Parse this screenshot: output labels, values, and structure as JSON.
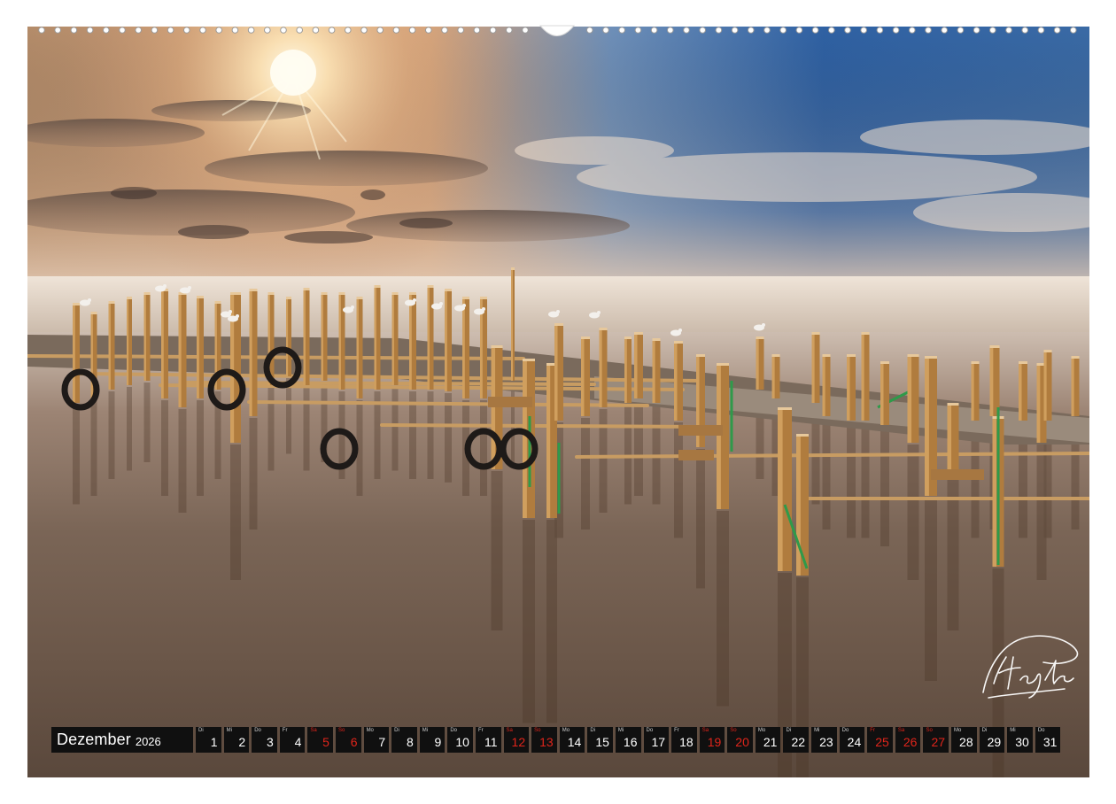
{
  "calendar": {
    "month": "Dezember",
    "year": "2026",
    "days": [
      {
        "abbr": "Di",
        "num": "1",
        "weekend": false
      },
      {
        "abbr": "Mi",
        "num": "2",
        "weekend": false
      },
      {
        "abbr": "Do",
        "num": "3",
        "weekend": false
      },
      {
        "abbr": "Fr",
        "num": "4",
        "weekend": false
      },
      {
        "abbr": "Sa",
        "num": "5",
        "weekend": true
      },
      {
        "abbr": "So",
        "num": "6",
        "weekend": true
      },
      {
        "abbr": "Mo",
        "num": "7",
        "weekend": false
      },
      {
        "abbr": "Di",
        "num": "8",
        "weekend": false
      },
      {
        "abbr": "Mi",
        "num": "9",
        "weekend": false
      },
      {
        "abbr": "Do",
        "num": "10",
        "weekend": false
      },
      {
        "abbr": "Fr",
        "num": "11",
        "weekend": false
      },
      {
        "abbr": "Sa",
        "num": "12",
        "weekend": true
      },
      {
        "abbr": "So",
        "num": "13",
        "weekend": true
      },
      {
        "abbr": "Mo",
        "num": "14",
        "weekend": false
      },
      {
        "abbr": "Di",
        "num": "15",
        "weekend": false
      },
      {
        "abbr": "Mi",
        "num": "16",
        "weekend": false
      },
      {
        "abbr": "Do",
        "num": "17",
        "weekend": false
      },
      {
        "abbr": "Fr",
        "num": "18",
        "weekend": false
      },
      {
        "abbr": "Sa",
        "num": "19",
        "weekend": true
      },
      {
        "abbr": "So",
        "num": "20",
        "weekend": true
      },
      {
        "abbr": "Mo",
        "num": "21",
        "weekend": false
      },
      {
        "abbr": "Di",
        "num": "22",
        "weekend": false
      },
      {
        "abbr": "Mi",
        "num": "23",
        "weekend": false
      },
      {
        "abbr": "Do",
        "num": "24",
        "weekend": false
      },
      {
        "abbr": "Fr",
        "num": "25",
        "weekend": true
      },
      {
        "abbr": "Sa",
        "num": "26",
        "weekend": true
      },
      {
        "abbr": "So",
        "num": "27",
        "weekend": true
      },
      {
        "abbr": "Mo",
        "num": "28",
        "weekend": false
      },
      {
        "abbr": "Di",
        "num": "29",
        "weekend": false
      },
      {
        "abbr": "Mi",
        "num": "30",
        "weekend": false
      },
      {
        "abbr": "Do",
        "num": "31",
        "weekend": false
      }
    ]
  },
  "colors": {
    "strip_background": "#101010",
    "weekday_text": "#ffffff",
    "weekend_text": "#e0251b"
  }
}
